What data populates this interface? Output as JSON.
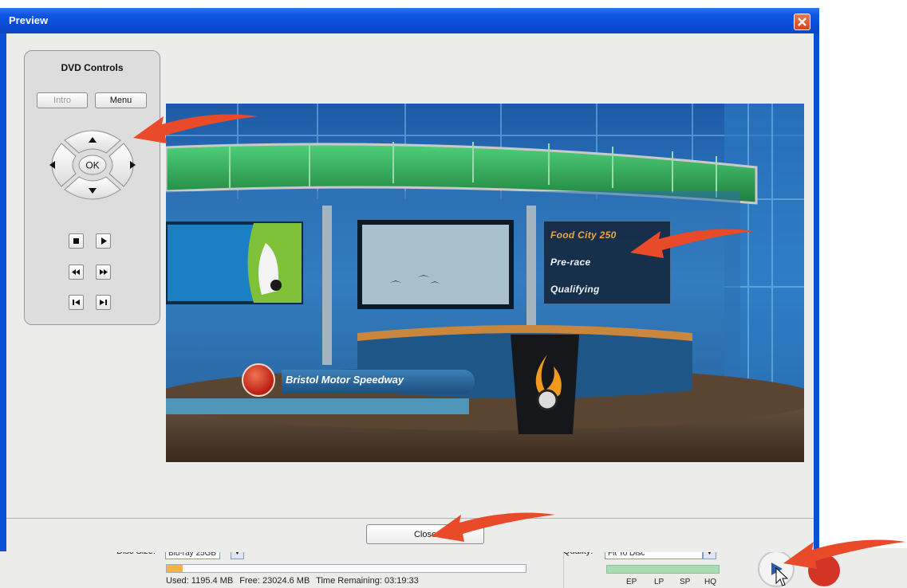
{
  "window": {
    "title": "Preview"
  },
  "dvd_controls": {
    "title": "DVD Controls",
    "intro_label": "Intro",
    "menu_label": "Menu",
    "ok_label": "OK"
  },
  "video": {
    "menu_items": [
      "Food City 250",
      "Pre-race",
      "Qualifying"
    ],
    "selected_index": 0,
    "lower_third": "Bristol Motor Speedway"
  },
  "dialog": {
    "close_label": "Close"
  },
  "app": {
    "disc_size_label": "Disc Size:",
    "disc_size_value": "Blu-ray 25GB",
    "usage_fraction": 0.045,
    "used": "Used: 1195.4 MB",
    "free": "Free: 23024.6 MB",
    "time_remaining": "Time Remaining: 03:19:33",
    "quality_label": "Quality:",
    "quality_value": "Fit To Disc",
    "quality_options": [
      "EP",
      "LP",
      "SP",
      "HQ"
    ]
  },
  "colors": {
    "titlebar": "#0a4fd6",
    "arrow": "#e84a2a",
    "menu_selected": "#f2a63a",
    "usage_fill": "#f5b342",
    "quality_bar": "#a9dcb3"
  }
}
